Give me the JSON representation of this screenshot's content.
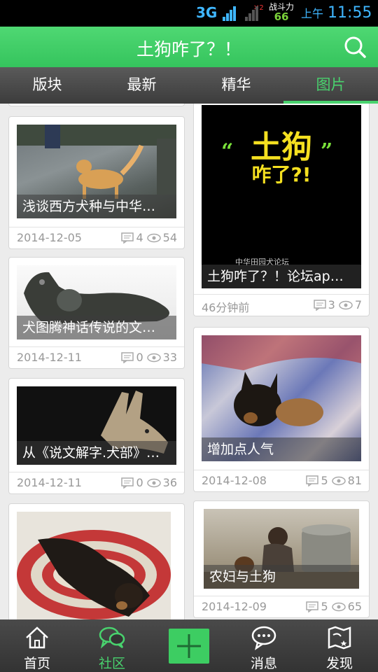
{
  "status_bar": {
    "network": "3G",
    "game_label": "战斗力",
    "game_value": "66",
    "ampm": "上午",
    "time": "11:55"
  },
  "header": {
    "title": "土狗咋了？！"
  },
  "tabs": [
    {
      "label": "版块"
    },
    {
      "label": "最新"
    },
    {
      "label": "精华"
    },
    {
      "label": "图片",
      "active": true
    }
  ],
  "posts": [
    {
      "caption": "浅谈西方犬种与中华…",
      "date": "2014-12-05",
      "comments": "4",
      "views": "54"
    },
    {
      "caption": "土狗咋了？！论坛ap…",
      "date": "46分钟前",
      "comments": "3",
      "views": "7"
    },
    {
      "caption": "犬图腾神话传说的文…",
      "date": "2014-12-11",
      "comments": "0",
      "views": "33"
    },
    {
      "caption": "增加点人气",
      "date": "2014-12-08",
      "comments": "5",
      "views": "81"
    },
    {
      "caption": "从《说文解字.犬部》…",
      "date": "2014-12-11",
      "comments": "0",
      "views": "36"
    },
    {
      "caption": "农妇与土狗",
      "date": "2014-12-09",
      "comments": "5",
      "views": "65"
    },
    {
      "caption": "",
      "date": "",
      "comments": "",
      "views": ""
    }
  ],
  "poster_text": {
    "line1": "土狗",
    "line2": "咋了?!",
    "forum": "中华田园犬论坛"
  },
  "bottom_nav": [
    {
      "label": "首页",
      "icon": "home-icon"
    },
    {
      "label": "社区",
      "icon": "community-icon",
      "active": true
    },
    {
      "label": "",
      "icon": "plus-icon"
    },
    {
      "label": "消息",
      "icon": "message-icon"
    },
    {
      "label": "发现",
      "icon": "discover-map-icon"
    }
  ],
  "colors": {
    "accent": "#49d36e",
    "header": "#3cc862",
    "tabbar": "#444444",
    "navbar": "#3a3a3a"
  }
}
